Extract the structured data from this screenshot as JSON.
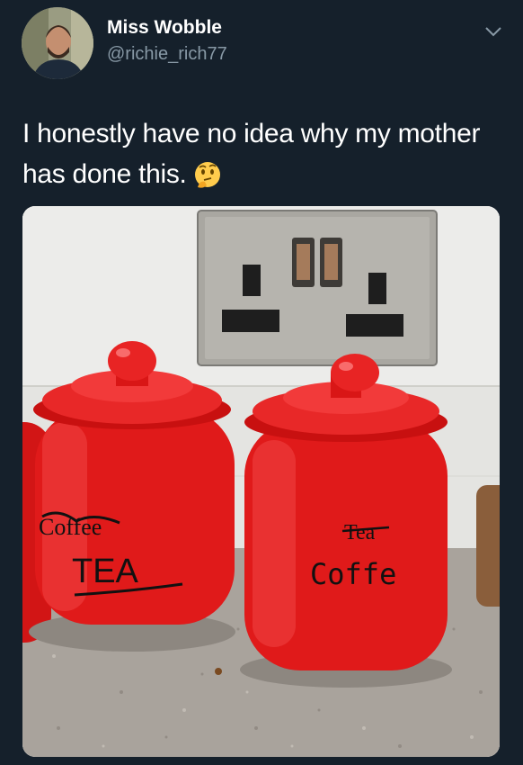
{
  "tweet": {
    "author_name": "Miss Wobble",
    "author_handle": "@richie_rich77",
    "text": "I honestly have no idea why my mother has done this.",
    "emoji": "thinking-face-emoji"
  },
  "photo": {
    "left_jar": {
      "crossed_label": "Coffee",
      "label": "TEA"
    },
    "right_jar": {
      "crossed_label": "Tea",
      "label": "Coffe"
    }
  },
  "colors": {
    "background": "#15202b",
    "secondary_text": "#8899a6",
    "jar_red": "#e01a1a"
  }
}
